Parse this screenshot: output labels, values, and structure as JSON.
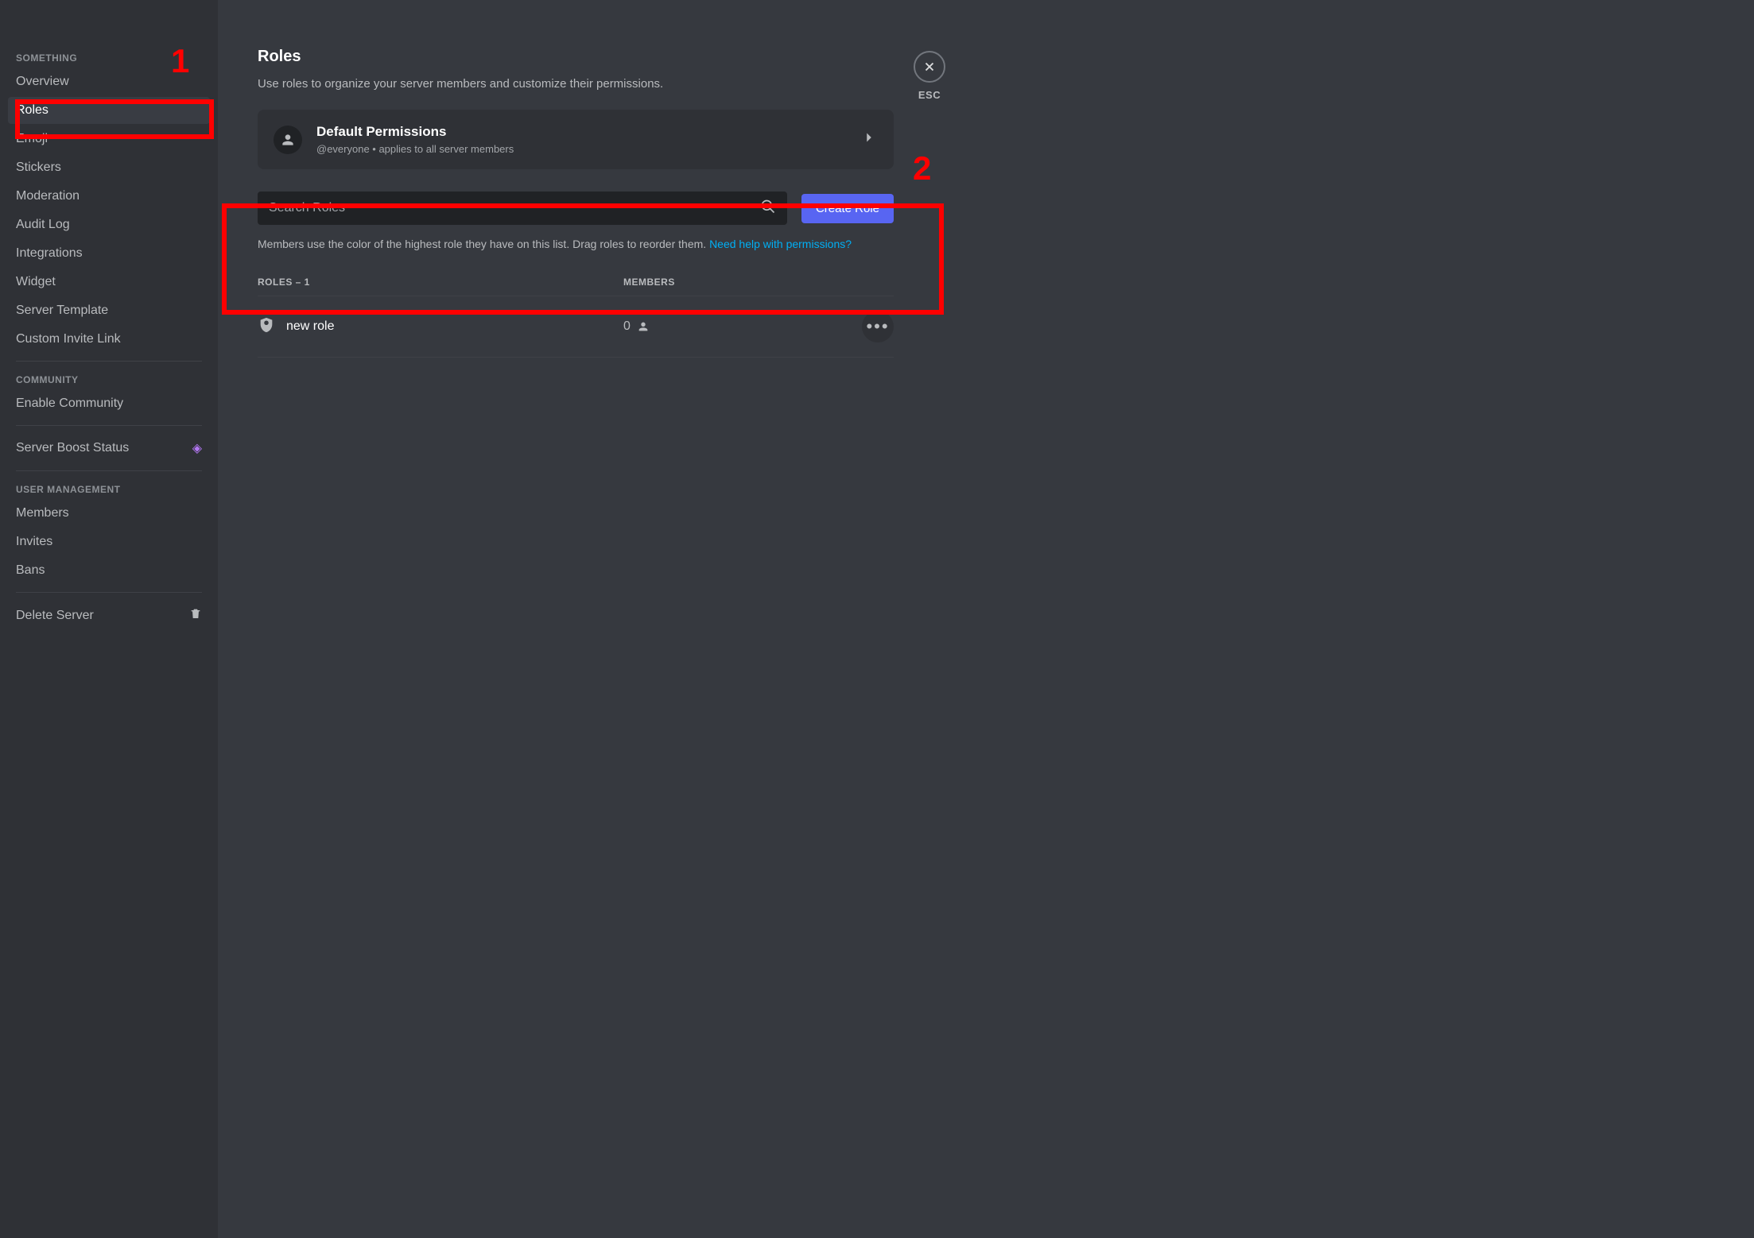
{
  "sidebar": {
    "sections": [
      {
        "header": "SOMETHING",
        "items": [
          {
            "label": "Overview",
            "selected": false
          },
          {
            "label": "Roles",
            "selected": true
          },
          {
            "label": "Emoji",
            "selected": false
          },
          {
            "label": "Stickers",
            "selected": false
          },
          {
            "label": "Moderation",
            "selected": false
          },
          {
            "label": "Audit Log",
            "selected": false
          },
          {
            "label": "Integrations",
            "selected": false
          },
          {
            "label": "Widget",
            "selected": false
          },
          {
            "label": "Server Template",
            "selected": false
          },
          {
            "label": "Custom Invite Link",
            "selected": false
          }
        ]
      },
      {
        "header": "COMMUNITY",
        "items": [
          {
            "label": "Enable Community",
            "selected": false
          }
        ]
      },
      {
        "header": "",
        "items": [
          {
            "label": "Server Boost Status",
            "selected": false,
            "icon": "boost"
          }
        ]
      },
      {
        "header": "USER MANAGEMENT",
        "items": [
          {
            "label": "Members",
            "selected": false
          },
          {
            "label": "Invites",
            "selected": false
          },
          {
            "label": "Bans",
            "selected": false
          }
        ]
      },
      {
        "header": "",
        "items": [
          {
            "label": "Delete Server",
            "selected": false,
            "icon": "trash"
          }
        ]
      }
    ]
  },
  "close": {
    "esc": "ESC"
  },
  "page": {
    "title": "Roles",
    "subtitle": "Use roles to organize your server members and customize their permissions."
  },
  "defaultCard": {
    "title": "Default Permissions",
    "subtitle": "@everyone • applies to all server members"
  },
  "search": {
    "placeholder": "Search Roles",
    "value": ""
  },
  "createButton": "Create Role",
  "helpText": {
    "prefix": "Members use the color of the highest role they have on this list. Drag roles to reorder them. ",
    "link": "Need help with permissions?"
  },
  "table": {
    "rolesHeader": "ROLES – 1",
    "membersHeader": "MEMBERS",
    "rows": [
      {
        "name": "new role",
        "members": 0
      }
    ]
  },
  "annotations": {
    "one": "1",
    "two": "2"
  }
}
